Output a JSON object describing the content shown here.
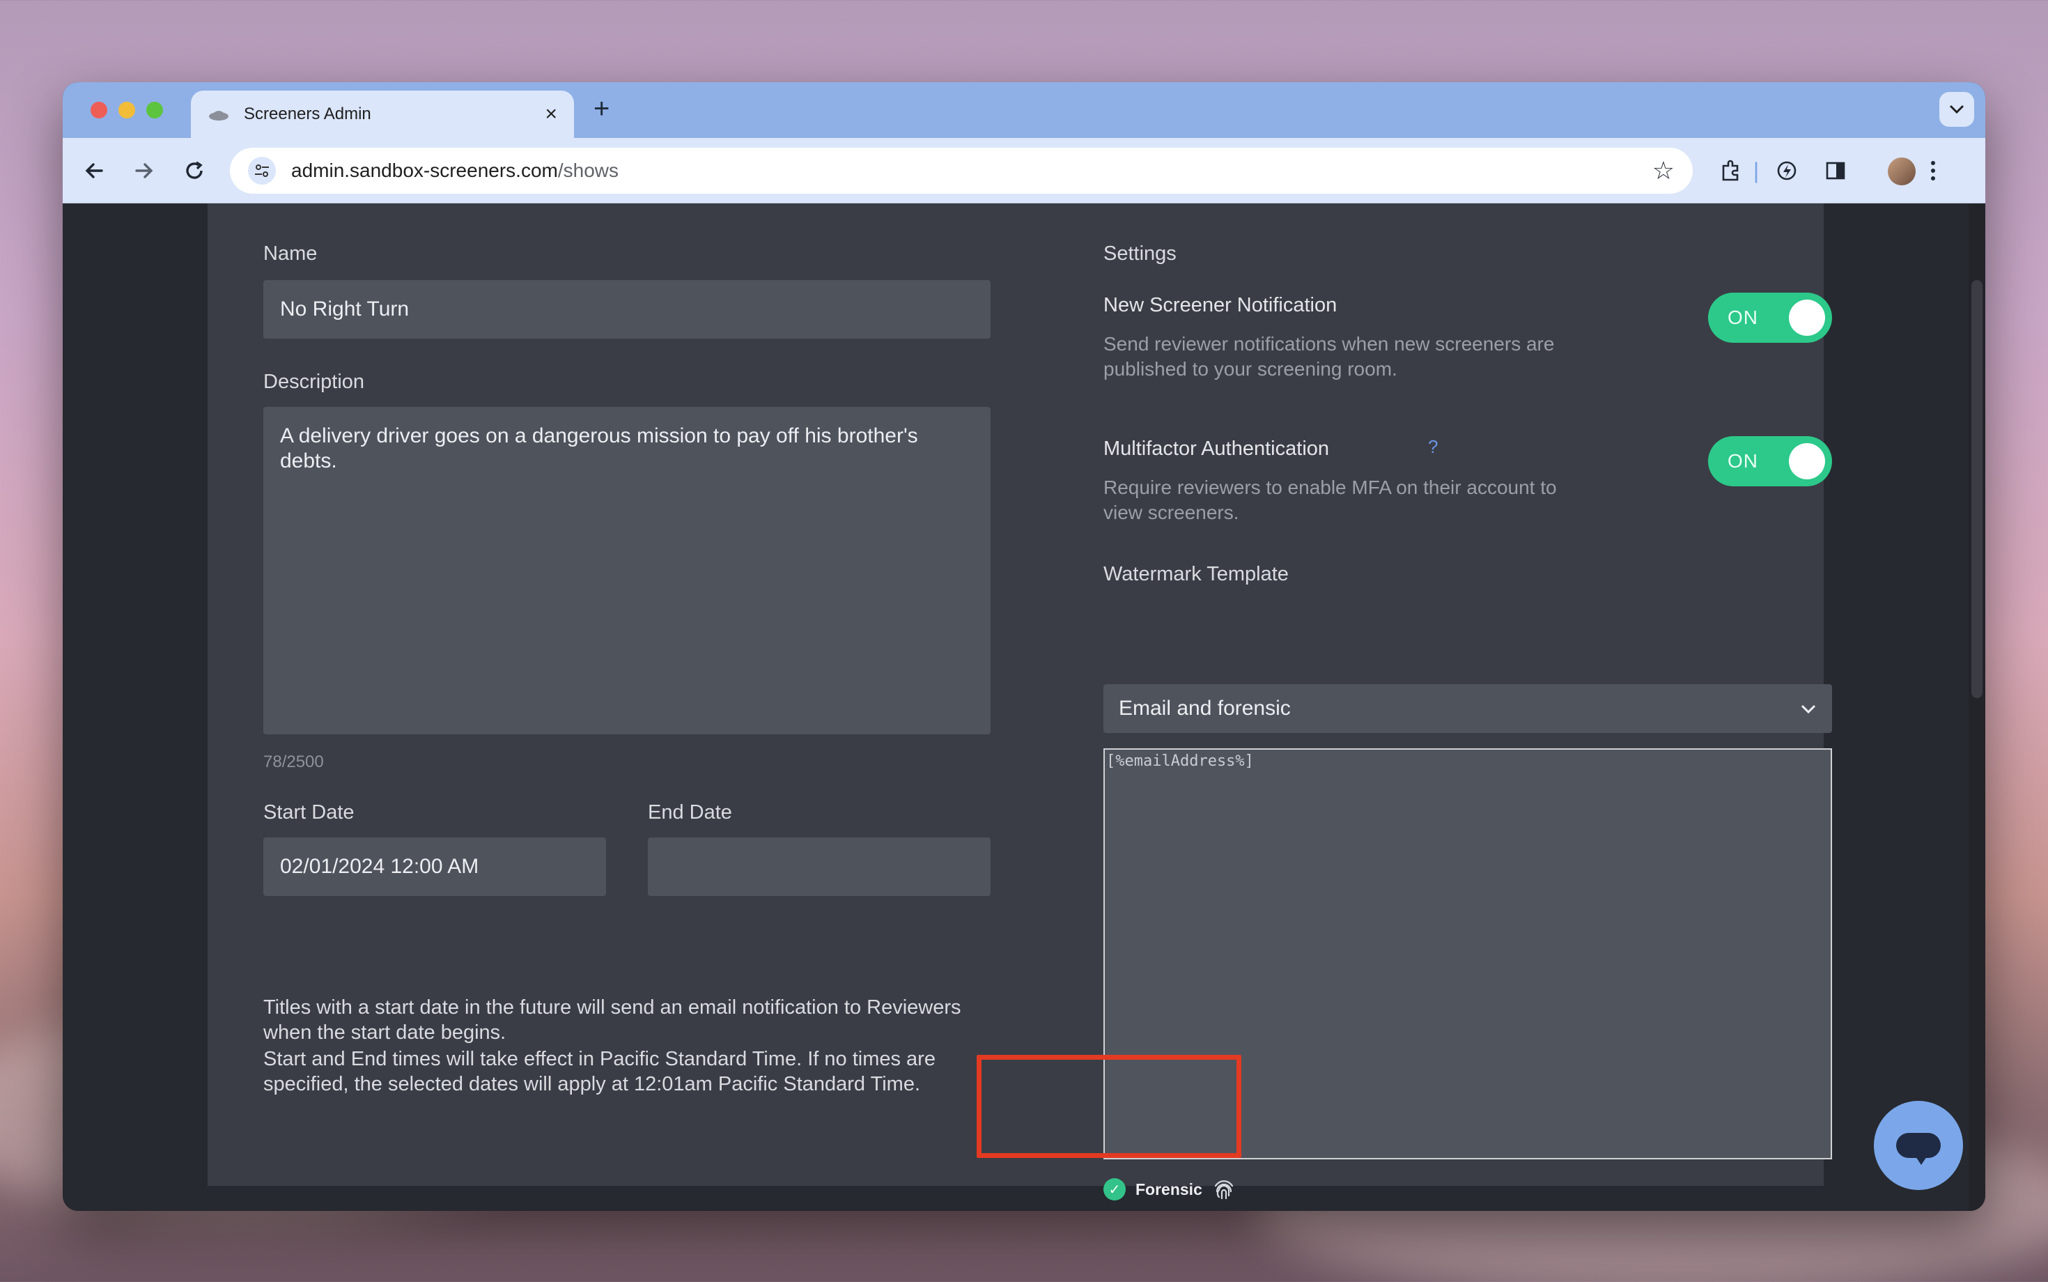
{
  "browser": {
    "tab_title": "Screeners Admin",
    "tab_close": "×",
    "new_tab": "+",
    "url_host": "admin.sandbox-screeners.com",
    "url_path": "/shows"
  },
  "form": {
    "name_label": "Name",
    "name_value": "No Right Turn",
    "description_label": "Description",
    "description_value": "A delivery driver goes on a dangerous mission to pay off his brother's debts.",
    "char_count": "78/2500",
    "start_date_label": "Start Date",
    "start_date_value": "02/01/2024 12:00 AM",
    "end_date_label": "End Date",
    "end_date_value": "",
    "start_date_note": "Titles with a start date in the future will send an email notification to Reviewers when the start date begins.",
    "timezone_note": "Start and End times will take effect in Pacific Standard Time. If no times are specified, the selected dates will apply at 12:01am Pacific Standard Time."
  },
  "settings": {
    "heading": "Settings",
    "new_screener": {
      "title": "New Screener Notification",
      "description": "Send reviewer notifications when new screeners are published to your screening room.",
      "toggle": "ON"
    },
    "mfa": {
      "title": "Multifactor Authentication",
      "help": "?",
      "description": "Require reviewers to enable MFA on their account to view screeners.",
      "toggle": "ON"
    },
    "watermark": {
      "label": "Watermark Template",
      "selected": "Email and forensic",
      "template_text": "[%emailAddress%]",
      "forensic_label": "Forensic"
    }
  },
  "colors": {
    "accent_green": "#2cc98a",
    "highlight_red": "#e33a22",
    "chat_blue": "#7ba7ea"
  }
}
